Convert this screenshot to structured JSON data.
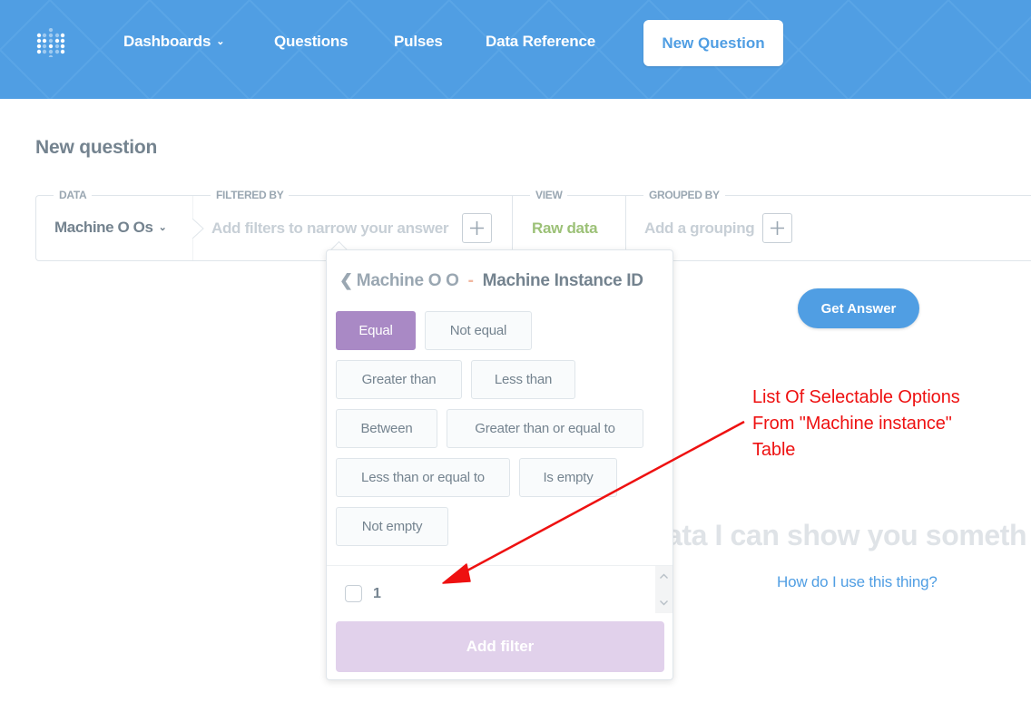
{
  "nav": {
    "items": [
      {
        "label": "Dashboards",
        "has_dropdown": true
      },
      {
        "label": "Questions"
      },
      {
        "label": "Pulses"
      },
      {
        "label": "Data Reference"
      }
    ],
    "new_question_label": "New Question"
  },
  "page": {
    "title": "New question"
  },
  "query_builder": {
    "data": {
      "label": "DATA",
      "value": "Machine O Os"
    },
    "filtered_by": {
      "label": "FILTERED BY",
      "placeholder": "Add filters to narrow your answer"
    },
    "view": {
      "label": "VIEW",
      "value": "Raw data"
    },
    "grouped_by": {
      "label": "GROUPED BY",
      "placeholder": "Add a grouping"
    }
  },
  "get_answer_label": "Get Answer",
  "background_hint": "ata I can show you someth",
  "help_link": "How do I use this thing?",
  "filter_popover": {
    "table": "Machine O O",
    "separator": "-",
    "field": "Machine Instance ID",
    "operators": [
      {
        "label": "Equal",
        "selected": true
      },
      {
        "label": "Not equal"
      },
      {
        "label": "Greater than"
      },
      {
        "label": "Less than"
      },
      {
        "label": "Between"
      },
      {
        "label": "Greater than or equal to"
      },
      {
        "label": "Less than or equal to"
      },
      {
        "label": "Is empty"
      },
      {
        "label": "Not empty"
      }
    ],
    "values": [
      {
        "label": "1",
        "checked": false
      }
    ],
    "add_filter_label": "Add filter"
  },
  "annotation": {
    "lines": [
      "List Of Selectable Options",
      "From \"Machine instance\"",
      "Table"
    ],
    "color": "#ee1111"
  },
  "colors": {
    "brand": "#509ee3",
    "filter": "#a989c5",
    "view": "#9cc177",
    "text": "#74838f"
  }
}
